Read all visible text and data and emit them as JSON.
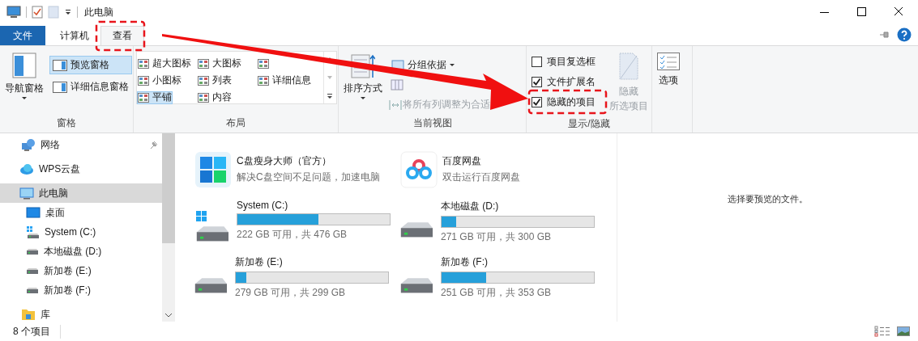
{
  "window": {
    "title": "此电脑"
  },
  "ribbon_tabs": [
    {
      "label": "文件",
      "kind": "file",
      "selected": false
    },
    {
      "label": "计算机",
      "kind": "tab",
      "selected": false
    },
    {
      "label": "查看",
      "kind": "tab",
      "selected": true
    }
  ],
  "ribbon": {
    "panes": {
      "label": "窗格",
      "nav_pane": "导航窗格",
      "items": [
        {
          "label": "预览窗格",
          "selected": true
        },
        {
          "label": "详细信息窗格",
          "selected": false
        }
      ]
    },
    "layout": {
      "label": "布局",
      "items": [
        {
          "label": "超大图标",
          "selected": false
        },
        {
          "label": "大图标",
          "selected": false
        },
        {
          "selected": false
        },
        {
          "label": "小图标",
          "selected": false
        },
        {
          "label": "列表",
          "selected": false
        },
        {
          "label": "详细信息",
          "selected": false
        },
        {
          "label": "平铺",
          "selected": true
        },
        {
          "label": "内容",
          "selected": false
        }
      ]
    },
    "current_view": {
      "label": "当前视图",
      "sort_by": "排序方式",
      "group_by": "分组依据",
      "fit_columns": {
        "label": "将所有列调整为合适",
        "disabled": true
      }
    },
    "show_hide": {
      "label": "显示/隐藏",
      "checkboxes": [
        {
          "label": "项目复选框",
          "checked": false
        },
        {
          "label": "文件扩展名",
          "checked": true
        },
        {
          "label": "隐藏的项目",
          "checked": true
        }
      ],
      "hide_selected": {
        "lines": [
          "隐藏",
          "所选项目"
        ],
        "disabled": true
      }
    },
    "options": {
      "label": "选项"
    }
  },
  "sidebar": {
    "items": [
      {
        "label": "网络",
        "pinned": true
      },
      {
        "label": "WPS云盘",
        "pinned": false
      },
      {
        "label": "此电脑",
        "pinned": false,
        "selected": true,
        "children": [
          {
            "label": "桌面",
            "selected": false
          },
          {
            "label": "System (C:)",
            "selected": false
          },
          {
            "label": "本地磁盘 (D:)",
            "selected": false
          },
          {
            "label": "新加卷 (E:)",
            "selected": false
          },
          {
            "label": "新加卷 (F:)",
            "selected": false
          }
        ]
      },
      {
        "label": "库",
        "pinned": false,
        "selected": false
      }
    ]
  },
  "apps": [
    {
      "name": "C盘瘦身大师（官方）",
      "description": "解决C盘空间不足问题，加速电脑"
    },
    {
      "name": "百度网盘",
      "description": "双击运行百度网盘"
    }
  ],
  "drives": [
    {
      "name": "System (C:)",
      "system": true,
      "level": 0.53,
      "usage": "222 GB 可用，共 476 GB"
    },
    {
      "name": "本地磁盘 (D:)",
      "system": false,
      "level": 0.095,
      "usage": "271 GB 可用，共 300 GB"
    },
    {
      "name": "新加卷 (E:)",
      "system": false,
      "level": 0.07,
      "usage": "279 GB 可用，共 299 GB"
    },
    {
      "name": "新加卷 (F:)",
      "system": false,
      "level": 0.29,
      "usage": "251 GB 可用，共 353 GB"
    }
  ],
  "preview": {
    "message": "选择要预览的文件。"
  },
  "status_bar": {
    "count": "8 个项目"
  }
}
